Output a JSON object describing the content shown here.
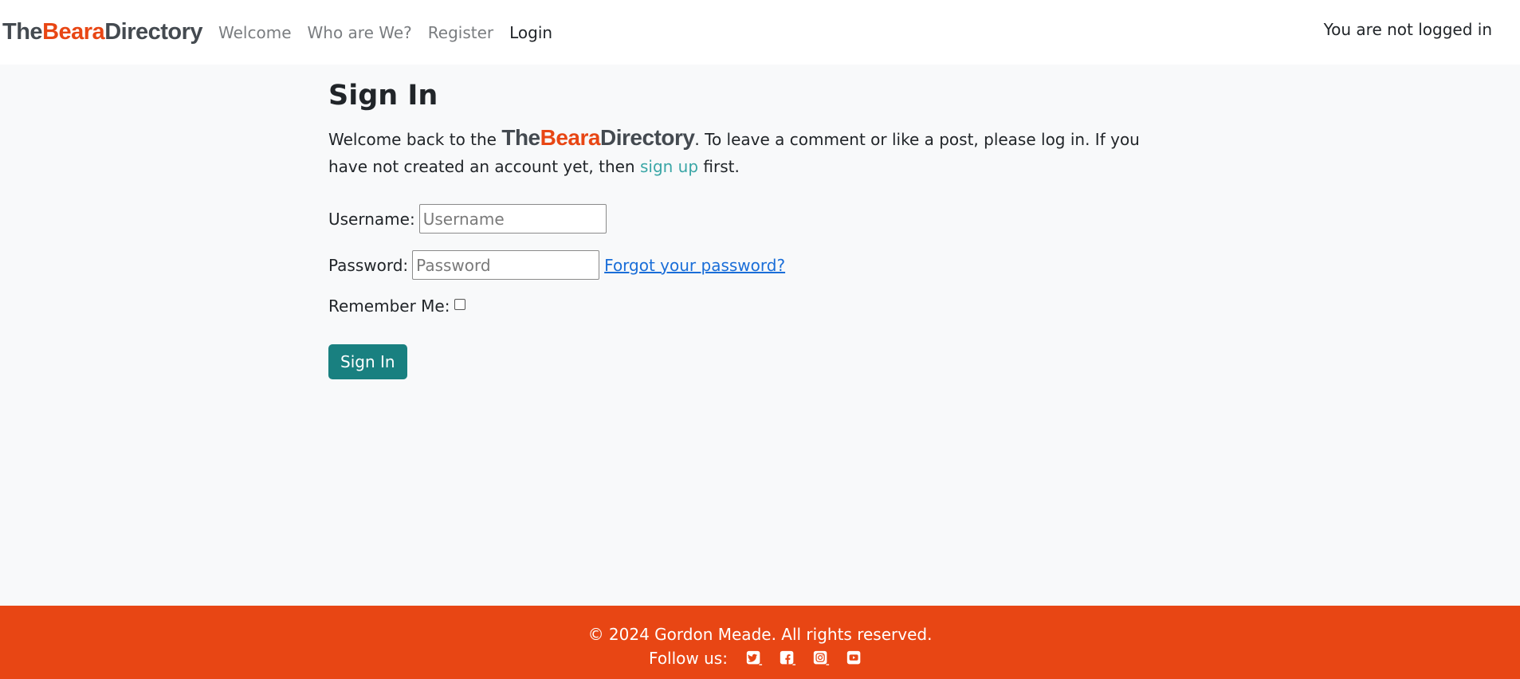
{
  "nav": {
    "brand": {
      "the": "The",
      "beara": "Beara",
      "directory": "Directory"
    },
    "links": [
      {
        "label": "Welcome"
      },
      {
        "label": "Who are We?"
      },
      {
        "label": "Register"
      },
      {
        "label": "Login"
      }
    ],
    "status": "You are not logged in"
  },
  "main": {
    "title": "Sign In",
    "intro_pre": "Welcome back to the ",
    "intro_brand": {
      "the": "The",
      "beara": "Beara",
      "directory": "Directory"
    },
    "intro_mid": ". To leave a comment or like a post, please log in. If you have not created an account yet, then ",
    "signup_link": "sign up",
    "intro_post": " first."
  },
  "form": {
    "username_label": "Username:",
    "username_placeholder": "Username",
    "password_label": "Password:",
    "password_placeholder": "Password",
    "forgot_link": "Forgot your password?",
    "remember_label": "Remember Me:",
    "submit_label": "Sign In"
  },
  "footer": {
    "copyright": "© 2024 Gordon Meade. All rights reserved.",
    "follow_label": "Follow us:",
    "social_icons": [
      "twitter-icon",
      "facebook-icon",
      "instagram-icon",
      "youtube-icon"
    ]
  },
  "colors": {
    "brand_orange": "#e84614",
    "button_teal": "#198080",
    "link_teal": "#3aa6a6",
    "link_blue": "#1a6ed8"
  }
}
